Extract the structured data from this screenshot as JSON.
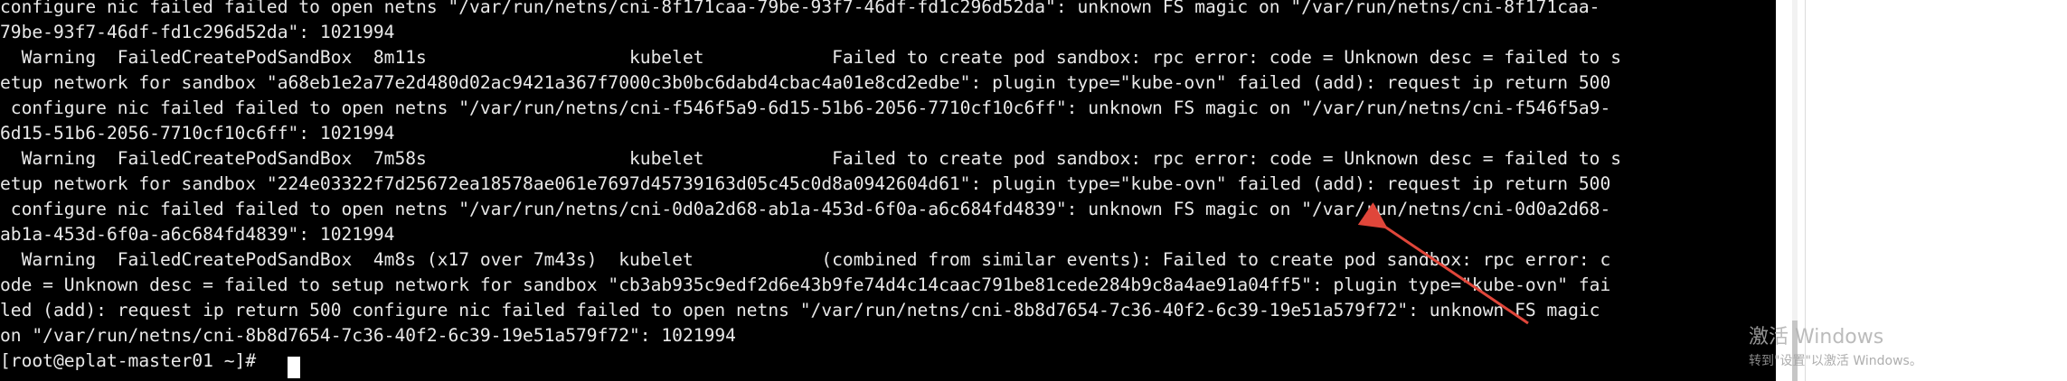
{
  "terminal": {
    "lines": [
      "configure nic failed failed to open netns \"/var/run/netns/cni-8f171caa-79be-93f7-46df-fd1c296d52da\": unknown FS magic on \"/var/run/netns/cni-8f171caa-",
      "79be-93f7-46df-fd1c296d52da\": 1021994",
      "  Warning  FailedCreatePodSandBox  8m11s                   kubelet            Failed to create pod sandbox: rpc error: code = Unknown desc = failed to s",
      "etup network for sandbox \"a68eb1e2a77e2d480d02ac9421a367f7000c3b0bc6dabd4cbac4a01e8cd2edbe\": plugin type=\"kube-ovn\" failed (add): request ip return 500",
      " configure nic failed failed to open netns \"/var/run/netns/cni-f546f5a9-6d15-51b6-2056-7710cf10c6ff\": unknown FS magic on \"/var/run/netns/cni-f546f5a9-",
      "6d15-51b6-2056-7710cf10c6ff\": 1021994",
      "  Warning  FailedCreatePodSandBox  7m58s                   kubelet            Failed to create pod sandbox: rpc error: code = Unknown desc = failed to s",
      "etup network for sandbox \"224e03322f7d25672ea18578ae061e7697d45739163d05c45c0d8a0942604d61\": plugin type=\"kube-ovn\" failed (add): request ip return 500",
      " configure nic failed failed to open netns \"/var/run/netns/cni-0d0a2d68-ab1a-453d-6f0a-a6c684fd4839\": unknown FS magic on \"/var/run/netns/cni-0d0a2d68-",
      "ab1a-453d-6f0a-a6c684fd4839\": 1021994",
      "  Warning  FailedCreatePodSandBox  4m8s (x17 over 7m43s)  kubelet            (combined from similar events): Failed to create pod sandbox: rpc error: c",
      "ode = Unknown desc = failed to setup network for sandbox \"cb3ab935c9edf2d6e43b9fe74d4c14caac791be81cede284b9c8a4ae91a04ff5\": plugin type=\"kube-ovn\" fai",
      "led (add): request ip return 500 configure nic failed failed to open netns \"/var/run/netns/cni-8b8d7654-7c36-40f2-6c39-19e51a579f72\": unknown FS magic",
      "on \"/var/run/netns/cni-8b8d7654-7c36-40f2-6c39-19e51a579f72\": 1021994",
      "[root@eplat-master01 ~]# "
    ]
  },
  "watermark": {
    "title": "激活 Windows",
    "subtitle": "转到\"设置\"以激活 Windows。"
  },
  "colors": {
    "terminal_bg": "#000000",
    "terminal_fg": "#e9e9e9",
    "annotation_arrow": "#e0463a"
  }
}
